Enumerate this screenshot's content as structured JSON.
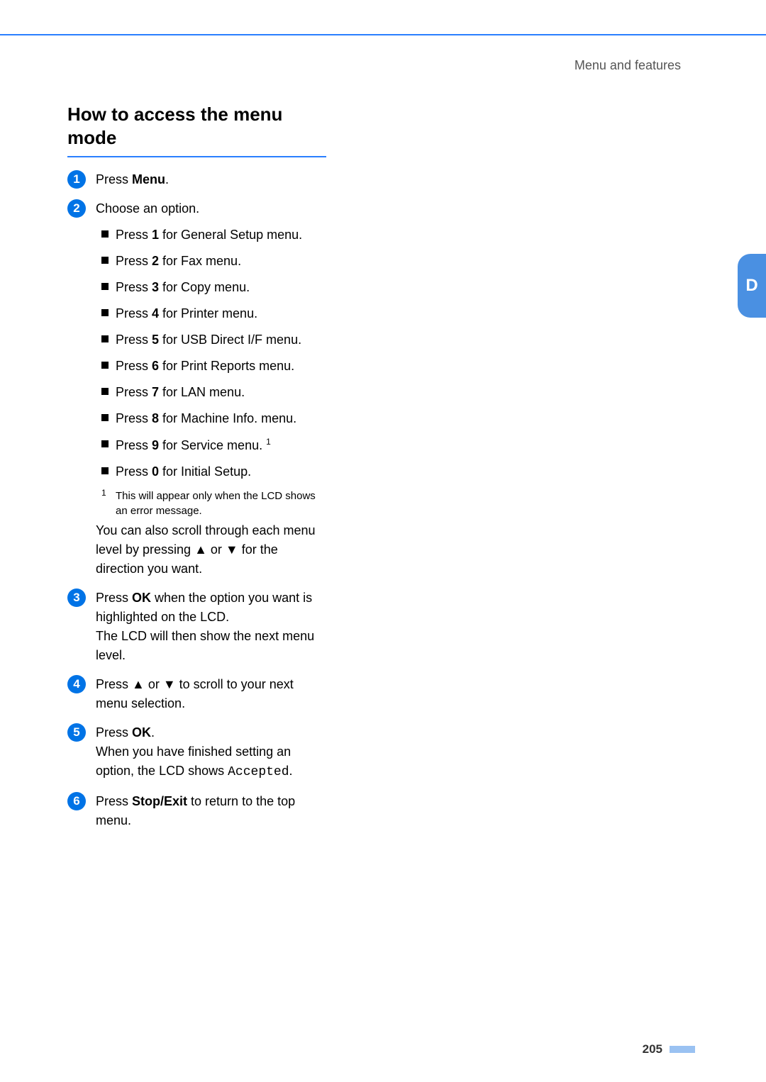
{
  "header": {
    "context": "Menu and features"
  },
  "section": {
    "title_line1": "How to access the menu",
    "title_line2": "mode"
  },
  "steps": [
    {
      "num": "1",
      "text_pre": "Press ",
      "bold": "Menu",
      "text_post": "."
    },
    {
      "num": "2",
      "text_pre": "Choose an option.",
      "bold": "",
      "text_post": "",
      "options": [
        {
          "pre": "Press ",
          "b": "1",
          "post": " for General Setup menu."
        },
        {
          "pre": "Press ",
          "b": "2",
          "post": " for Fax menu."
        },
        {
          "pre": "Press ",
          "b": "3",
          "post": " for Copy menu."
        },
        {
          "pre": "Press ",
          "b": "4",
          "post": " for Printer menu."
        },
        {
          "pre": "Press ",
          "b": "5",
          "post": " for USB Direct I/F menu."
        },
        {
          "pre": "Press ",
          "b": "6",
          "post": " for Print Reports menu."
        },
        {
          "pre": "Press ",
          "b": "7",
          "post": " for LAN menu."
        },
        {
          "pre": "Press ",
          "b": "8",
          "post": " for Machine Info. menu."
        },
        {
          "pre": "Press ",
          "b": "9",
          "post": " for Service menu.",
          "sup": "1"
        },
        {
          "pre": "Press ",
          "b": "0",
          "post": " for Initial Setup."
        }
      ],
      "footnote": {
        "mark": "1",
        "text": "This will appear only when the LCD shows an error message."
      },
      "scroll_note": "You can also scroll through each menu level by pressing ▲ or ▼ for the direction you want."
    },
    {
      "num": "3",
      "text_pre": "Press ",
      "bold": "OK",
      "text_post": " when the option you want is highlighted on the LCD.",
      "extra": "The LCD will then show the next menu level."
    },
    {
      "num": "4",
      "text_pre": "Press ▲ or ▼ to scroll to your next menu selection.",
      "bold": "",
      "text_post": ""
    },
    {
      "num": "5",
      "text_pre": "Press ",
      "bold": "OK",
      "text_post": ".",
      "extra_pre": "When you have finished setting an option, the LCD shows ",
      "extra_code": "Accepted",
      "extra_post": "."
    },
    {
      "num": "6",
      "text_pre": "Press ",
      "bold": "Stop/Exit",
      "text_post": " to return to the top menu."
    }
  ],
  "side_tab": {
    "letter": "D"
  },
  "page_number": "205"
}
